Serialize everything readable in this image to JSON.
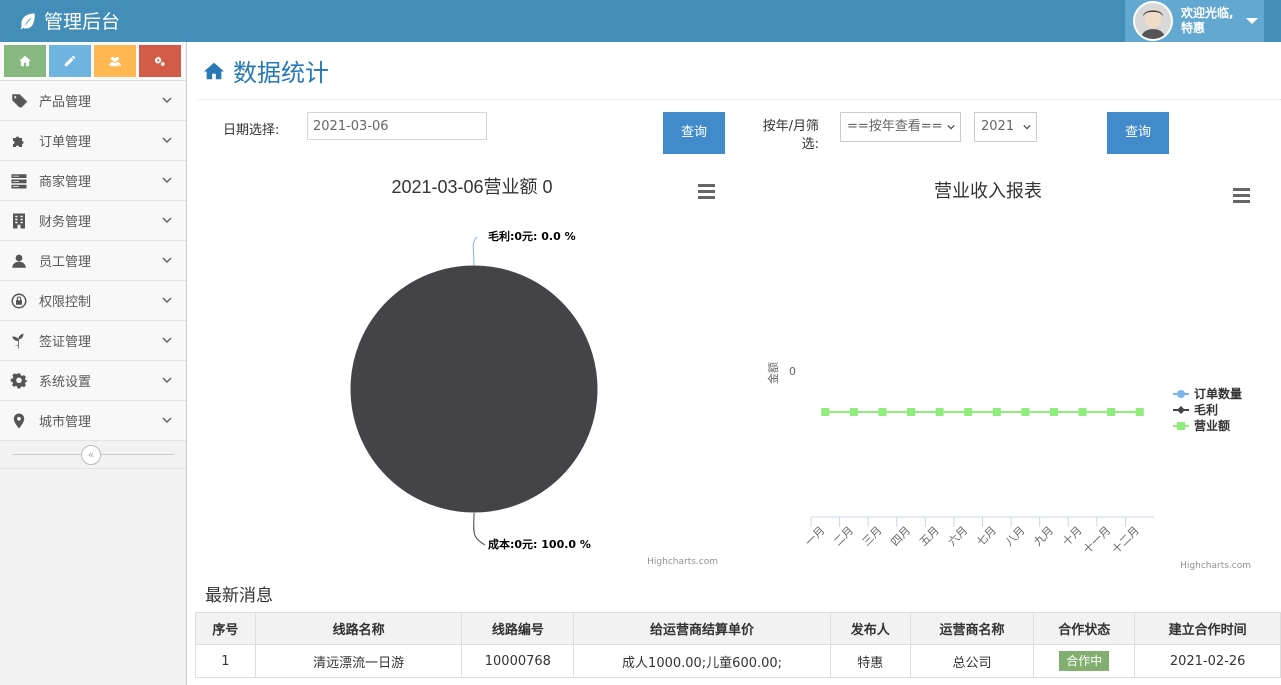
{
  "app": {
    "title": "管理后台"
  },
  "user": {
    "welcome": "欢迎光临,",
    "name": "特惠"
  },
  "colors": {
    "topbar": "#438eb9",
    "accent": "#2679b5",
    "button": "#428bca",
    "shortcut_green": "#87b87f",
    "shortcut_blue": "#6fb3e0",
    "shortcut_orange": "#ffb752",
    "shortcut_red": "#d15b47",
    "status_badge": "#82af6f",
    "pie": "#434348"
  },
  "shortcuts": [
    {
      "icon": "home-icon"
    },
    {
      "icon": "pencil-icon"
    },
    {
      "icon": "users-icon"
    },
    {
      "icon": "cogs-icon"
    }
  ],
  "sidebar": {
    "items": [
      {
        "label": "产品管理",
        "icon": "tags-icon"
      },
      {
        "label": "订单管理",
        "icon": "puzzle-icon"
      },
      {
        "label": "商家管理",
        "icon": "server-icon"
      },
      {
        "label": "财务管理",
        "icon": "building-icon"
      },
      {
        "label": "员工管理",
        "icon": "user-icon"
      },
      {
        "label": "权限控制",
        "icon": "lock-icon"
      },
      {
        "label": "签证管理",
        "icon": "leaf-icon"
      },
      {
        "label": "系统设置",
        "icon": "gear-icon"
      },
      {
        "label": "城市管理",
        "icon": "map-marker-icon"
      }
    ],
    "collapse_icon": "double-chevron-left-icon"
  },
  "page": {
    "title": "数据统计",
    "icon": "home-icon"
  },
  "filters": {
    "date_label": "日期选择:",
    "date_value": "2021-03-06",
    "query_label": "查询",
    "year_month_label_1": "按年/月筛",
    "year_month_label_2": "选:",
    "mode_select": "==按年查看==",
    "year_select": "2021",
    "query2_label": "查询"
  },
  "chart_data": [
    {
      "type": "pie",
      "title": "2021-03-06营业额 0",
      "slices": [
        {
          "name": "毛利",
          "value": 0,
          "percent": 0.0,
          "label": "毛利:0元: 0.0 %"
        },
        {
          "name": "成本",
          "value": 0,
          "percent": 100.0,
          "label": "成本:0元: 100.0 %"
        }
      ],
      "credit": "Highcharts.com"
    },
    {
      "type": "line",
      "title": "营业收入报表",
      "ylabel": "金额",
      "categories": [
        "一月",
        "二月",
        "三月",
        "四月",
        "五月",
        "六月",
        "七月",
        "八月",
        "九月",
        "十月",
        "十一月",
        "十二月"
      ],
      "yticks": [
        "0"
      ],
      "series": [
        {
          "name": "订单数量",
          "color": "#7cb5ec",
          "values": [
            0,
            0,
            0,
            0,
            0,
            0,
            0,
            0,
            0,
            0,
            0,
            0
          ]
        },
        {
          "name": "毛利",
          "color": "#434348",
          "values": [
            0,
            0,
            0,
            0,
            0,
            0,
            0,
            0,
            0,
            0,
            0,
            0
          ]
        },
        {
          "name": "营业额",
          "color": "#90ed7d",
          "values": [
            0,
            0,
            0,
            0,
            0,
            0,
            0,
            0,
            0,
            0,
            0,
            0
          ]
        }
      ],
      "legend": "right",
      "credit": "Highcharts.com"
    }
  ],
  "news": {
    "title": "最新消息",
    "columns": [
      "序号",
      "线路名称",
      "线路编号",
      "给运营商结算单价",
      "发布人",
      "运营商名称",
      "合作状态",
      "建立合作时间"
    ],
    "rows": [
      [
        "1",
        "清远漂流一日游",
        "10000768",
        "成人1000.00;儿童600.00;",
        "特惠",
        "总公司",
        "合作中",
        "2021-02-26"
      ]
    ]
  }
}
